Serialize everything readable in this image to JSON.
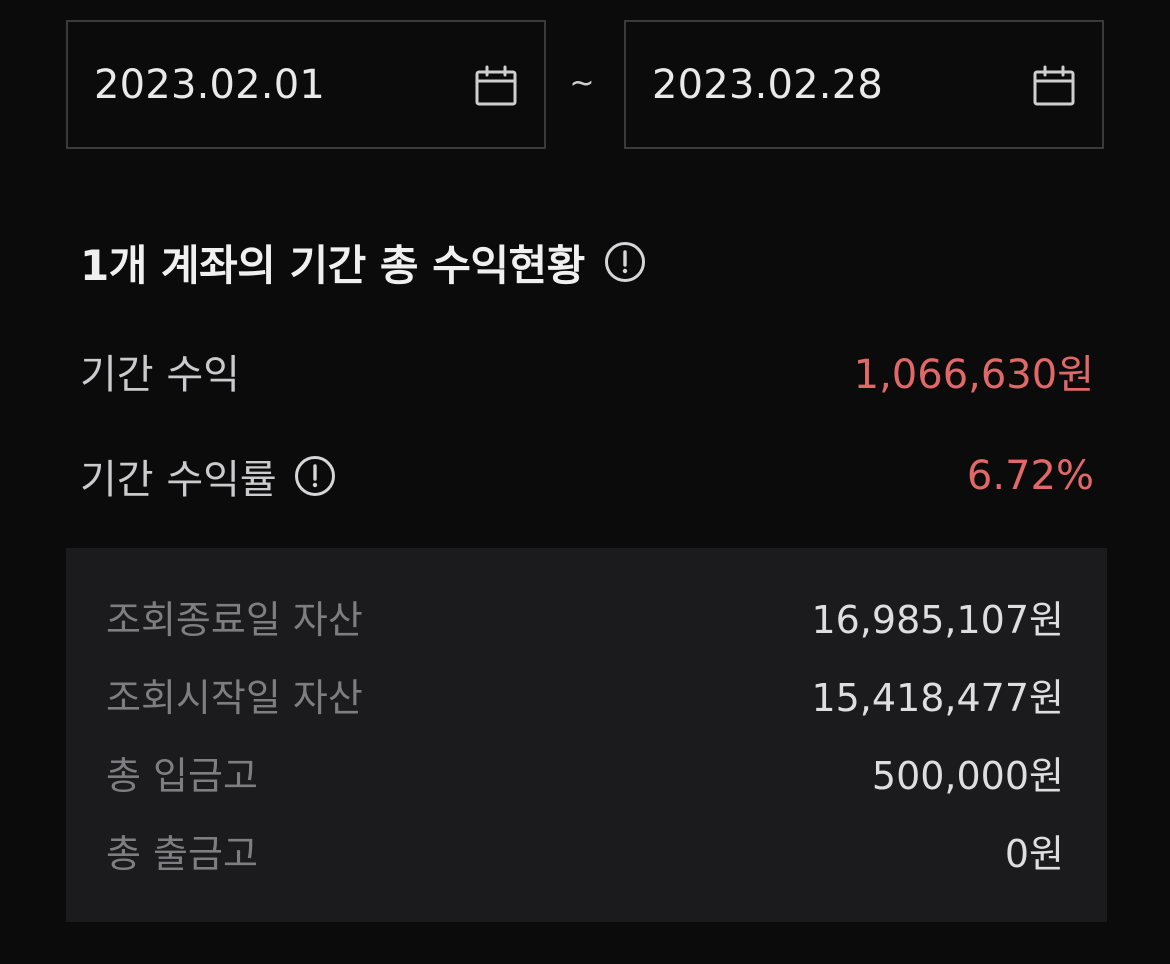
{
  "date_range": {
    "start_date": "2023.02.01",
    "separator": "~",
    "end_date": "2023.02.28",
    "start_icon": "calendar-icon",
    "end_icon": "calendar-icon"
  },
  "summary": {
    "title": "1개 계좌의 기간 총 수익현황",
    "title_icon": "info-icon",
    "period_profit_label": "기간 수익",
    "period_profit_value": "1,066,630원",
    "period_return_label": "기간 수익률",
    "period_return_icon": "info-icon",
    "period_return_value": "6.72%"
  },
  "details": [
    {
      "label": "조회종료일 자산",
      "value": "16,985,107원"
    },
    {
      "label": "조회시작일 자산",
      "value": "15,418,477원"
    },
    {
      "label": "총 입금고",
      "value": "500,000원"
    },
    {
      "label": "총 출금고",
      "value": "0원"
    }
  ],
  "colors": {
    "background": "#0b0b0c",
    "panel": "#1b1b1d",
    "positive": "#e26868",
    "border": "#3a3a3d"
  }
}
